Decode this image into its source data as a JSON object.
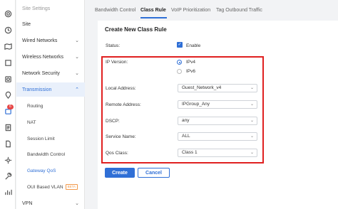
{
  "menu": {
    "header": "Site Settings",
    "items": [
      {
        "label": "Site"
      },
      {
        "label": "Wired Networks"
      },
      {
        "label": "Wireless Networks"
      },
      {
        "label": "Network Security"
      },
      {
        "label": "Transmission"
      }
    ],
    "sub_items": [
      {
        "label": "Routing"
      },
      {
        "label": "NAT"
      },
      {
        "label": "Session Limit"
      },
      {
        "label": "Bandwidth Control"
      },
      {
        "label": "Gateway QoS"
      },
      {
        "label": "OUI Based VLAN"
      }
    ],
    "beta_badge": "BETA",
    "vpn": "VPN"
  },
  "rail": {
    "badge": "6"
  },
  "tabs": [
    {
      "label": "Bandwidth Control"
    },
    {
      "label": "Class Rule"
    },
    {
      "label": "VoIP Prioritization"
    },
    {
      "label": "Tag Outbound Traffic"
    }
  ],
  "form": {
    "title": "Create New Class Rule",
    "status_label": "Status:",
    "enable_label": "Enable",
    "ip_version_label": "IP Version:",
    "ipv4": "IPv4",
    "ipv6": "IPv6",
    "local_address_label": "Local Address:",
    "local_address_value": "Guest_Network_v4",
    "remote_address_label": "Remote Address:",
    "remote_address_value": "IPGroup_Any",
    "dscp_label": "DSCP:",
    "dscp_value": "any",
    "service_name_label": "Service Name:",
    "service_name_value": "ALL",
    "qos_class_label": "Qos Class:",
    "qos_class_value": "Class 1",
    "create_label": "Create",
    "cancel_label": "Cancel"
  },
  "colors": {
    "accent": "#2f6fd6",
    "highlight_box": "#e02020",
    "badge": "#e64545"
  }
}
